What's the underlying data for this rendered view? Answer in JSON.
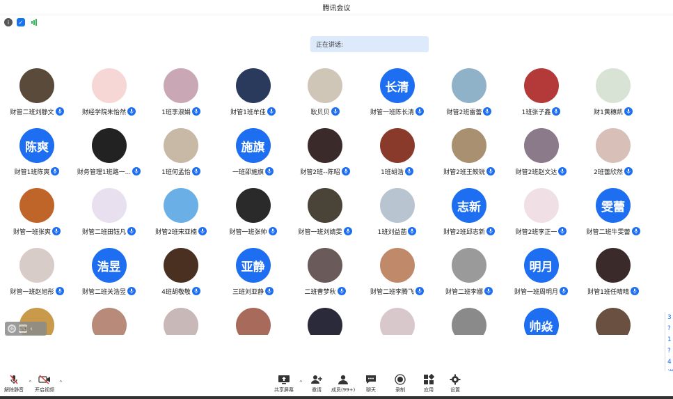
{
  "window": {
    "title": "腾讯会议"
  },
  "speaking": {
    "label": "正在讲话:"
  },
  "participants": [
    {
      "name": "财管二班刘静文",
      "avatar_type": "photo",
      "avatar_text": "",
      "color": "#5a4a3a"
    },
    {
      "name": "财经学院朱怡然",
      "avatar_type": "photo",
      "avatar_text": "",
      "color": "#f7d6d6"
    },
    {
      "name": "1班李淑娟",
      "avatar_type": "photo",
      "avatar_text": "",
      "color": "#c9a7b4"
    },
    {
      "name": "财管1班牟佳",
      "avatar_type": "photo",
      "avatar_text": "",
      "color": "#2a3a5c"
    },
    {
      "name": "耿贝贝",
      "avatar_type": "photo",
      "avatar_text": "",
      "color": "#cfc6b8"
    },
    {
      "name": "财管一班陈长清",
      "avatar_type": "text",
      "avatar_text": "长清",
      "color": "#1e6ef1"
    },
    {
      "name": "财管2班雷蕾",
      "avatar_type": "photo",
      "avatar_text": "",
      "color": "#8fb2c9"
    },
    {
      "name": "1班张子鑫",
      "avatar_type": "photo",
      "avatar_text": "",
      "color": "#b43a3a"
    },
    {
      "name": "财1黄穗凯",
      "avatar_type": "photo",
      "avatar_text": "",
      "color": "#d9e3d5"
    },
    {
      "name": "财管1班陈爽",
      "avatar_type": "text",
      "avatar_text": "陈爽",
      "color": "#1e6ef1"
    },
    {
      "name": "财务管理1班路一...",
      "avatar_type": "photo",
      "avatar_text": "",
      "color": "#222222"
    },
    {
      "name": "1班何孟怡",
      "avatar_type": "photo",
      "avatar_text": "",
      "color": "#c8b8a6"
    },
    {
      "name": "一班邵施旗",
      "avatar_type": "text",
      "avatar_text": "施旗",
      "color": "#1e6ef1"
    },
    {
      "name": "财管2班--陈昭",
      "avatar_type": "photo",
      "avatar_text": "",
      "color": "#3a2a2a"
    },
    {
      "name": "1班胡浩",
      "avatar_type": "photo",
      "avatar_text": "",
      "color": "#8a3a2a"
    },
    {
      "name": "财管2班王鲛锐",
      "avatar_type": "photo",
      "avatar_text": "",
      "color": "#a89070"
    },
    {
      "name": "财管2班赵文达",
      "avatar_type": "photo",
      "avatar_text": "",
      "color": "#8a7a8a"
    },
    {
      "name": "2班蕾欣然",
      "avatar_type": "photo",
      "avatar_text": "",
      "color": "#d8c0b8"
    },
    {
      "name": "财管一班张爽",
      "avatar_type": "photo",
      "avatar_text": "",
      "color": "#c0652a"
    },
    {
      "name": "财管二班田钰凡",
      "avatar_type": "photo",
      "avatar_text": "",
      "color": "#e8e0ee"
    },
    {
      "name": "财管2班宋亚楠",
      "avatar_type": "photo",
      "avatar_text": "",
      "color": "#6ab0e6"
    },
    {
      "name": "财管一班张帅",
      "avatar_type": "photo",
      "avatar_text": "",
      "color": "#2a2a2a"
    },
    {
      "name": "财管一班刘婧雯",
      "avatar_type": "photo",
      "avatar_text": "",
      "color": "#4a4438"
    },
    {
      "name": "1班刘益菡",
      "avatar_type": "photo",
      "avatar_text": "",
      "color": "#b8c4d0"
    },
    {
      "name": "财管2班邱志新",
      "avatar_type": "text",
      "avatar_text": "志新",
      "color": "#1e6ef1"
    },
    {
      "name": "财管2班李正一",
      "avatar_type": "photo",
      "avatar_text": "",
      "color": "#f0e0e6"
    },
    {
      "name": "财管二班牛雯蕾",
      "avatar_type": "text",
      "avatar_text": "雯蕾",
      "color": "#1e6ef1"
    },
    {
      "name": "财管一班赵旭彤",
      "avatar_type": "photo",
      "avatar_text": "",
      "color": "#d8ccc8"
    },
    {
      "name": "财管二班关浩昱",
      "avatar_type": "text",
      "avatar_text": "浩昱",
      "color": "#1e6ef1"
    },
    {
      "name": "4班胡敬敬",
      "avatar_type": "photo",
      "avatar_text": "",
      "color": "#4a3020"
    },
    {
      "name": "三班刘亚静",
      "avatar_type": "text",
      "avatar_text": "亚静",
      "color": "#1e6ef1"
    },
    {
      "name": "二班曹梦秋",
      "avatar_type": "photo",
      "avatar_text": "",
      "color": "#6a5a5a"
    },
    {
      "name": "财管二班李腾飞",
      "avatar_type": "photo",
      "avatar_text": "",
      "color": "#c08a6a"
    },
    {
      "name": "财管二班李娜",
      "avatar_type": "photo",
      "avatar_text": "",
      "color": "#9a9a9a"
    },
    {
      "name": "财管一班周明月",
      "avatar_type": "text",
      "avatar_text": "明月",
      "color": "#1e6ef1"
    },
    {
      "name": "财管1班任晴晴",
      "avatar_type": "photo",
      "avatar_text": "",
      "color": "#3a2a2a"
    },
    {
      "name": "",
      "avatar_type": "photo",
      "avatar_text": "",
      "color": "#c89a4a"
    },
    {
      "name": "",
      "avatar_type": "photo",
      "avatar_text": "",
      "color": "#b88a7a"
    },
    {
      "name": "",
      "avatar_type": "photo",
      "avatar_text": "",
      "color": "#c8b8b8"
    },
    {
      "name": "",
      "avatar_type": "photo",
      "avatar_text": "",
      "color": "#a86a5a"
    },
    {
      "name": "",
      "avatar_type": "photo",
      "avatar_text": "",
      "color": "#2a2a3a"
    },
    {
      "name": "",
      "avatar_type": "photo",
      "avatar_text": "",
      "color": "#d8c8cc"
    },
    {
      "name": "",
      "avatar_type": "photo",
      "avatar_text": "",
      "color": "#8a8a8a"
    },
    {
      "name": "",
      "avatar_type": "text",
      "avatar_text": "帅焱",
      "color": "#1e6ef1"
    },
    {
      "name": "",
      "avatar_type": "photo",
      "avatar_text": "",
      "color": "#6a5040"
    }
  ],
  "toolbar": {
    "mute": "解除静音",
    "video": "开启视频",
    "share": "共享屏幕",
    "invite": "邀请",
    "members": "成员(99+)",
    "chat": "聊天",
    "record": "录制",
    "apps": "应用",
    "settings": "设置"
  },
  "edge_panel": {
    "chars": [
      "3",
      "?",
      "1",
      "?",
      "4",
      "说"
    ]
  }
}
